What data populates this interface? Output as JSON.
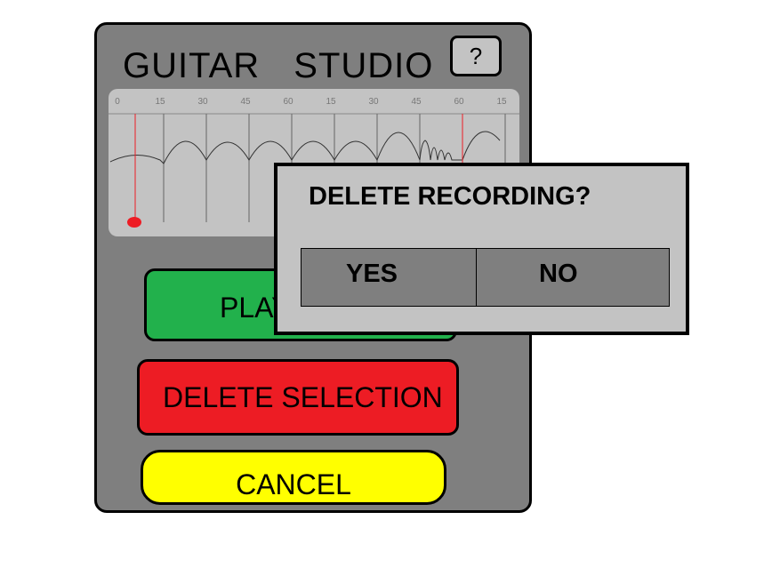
{
  "app": {
    "title": "GUITAR STUDIO",
    "help_label": "?"
  },
  "timeline": {
    "ticks": [
      "0",
      "15",
      "30",
      "45",
      "60",
      "15",
      "30",
      "45",
      "60",
      "15"
    ],
    "playhead_color": "#ed1c24"
  },
  "buttons": {
    "play_label": "PLAY",
    "delete_selection_label": "DELETE SELECTION",
    "cancel_label": "CANCEL"
  },
  "dialog": {
    "title": "DELETE RECORDING?",
    "yes_label": "YES",
    "no_label": "NO"
  },
  "colors": {
    "play": "#22b14c",
    "delete": "#ed1c24",
    "cancel": "#ffff00",
    "panel": "#7f7f7f",
    "dialog": "#c3c3c3"
  }
}
